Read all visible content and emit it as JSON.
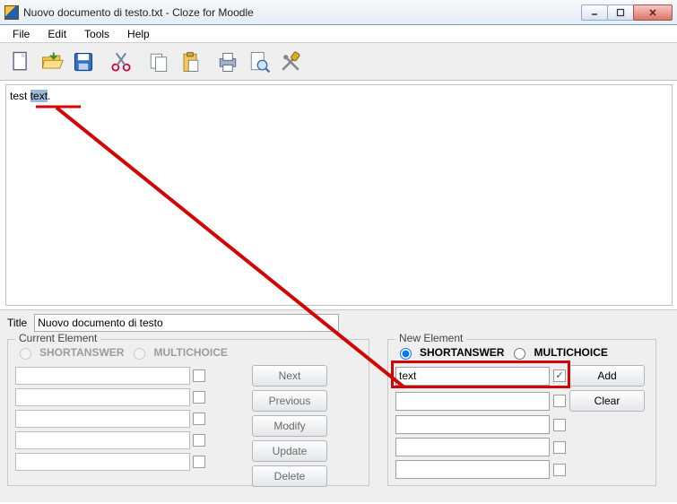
{
  "window": {
    "title": "Nuovo documento di testo.txt - Cloze for Moodle"
  },
  "menu": {
    "file": "File",
    "edit": "Edit",
    "tools": "Tools",
    "help": "Help"
  },
  "editor": {
    "before": "test ",
    "selected": "text",
    "after": "."
  },
  "title_field": {
    "label": "Title",
    "value": "Nuovo documento di testo"
  },
  "current": {
    "legend": "Current Element",
    "short": "SHORTANSWER",
    "multi": "MULTICHOICE",
    "btn_next": "Next",
    "btn_prev": "Previous",
    "btn_mod": "Modify",
    "btn_upd": "Update",
    "btn_del": "Delete"
  },
  "newel": {
    "legend": "New Element",
    "short": "SHORTANSWER",
    "multi": "MULTICHOICE",
    "input_value": "text",
    "btn_add": "Add",
    "btn_clear": "Clear"
  }
}
